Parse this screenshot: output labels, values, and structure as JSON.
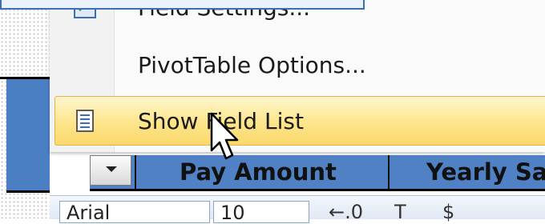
{
  "menu": {
    "items": [
      {
        "label": "Field Settings...",
        "icon": "field-settings-icon"
      },
      {
        "label": "PivotTable Options...",
        "icon": ""
      },
      {
        "label": "Show Field List",
        "icon": "field-list-icon",
        "highlighted": true
      }
    ]
  },
  "pivot_header": {
    "columns": [
      "Pay Amount",
      "Yearly Sa"
    ]
  },
  "format_toolbar": {
    "font_name": "Arial",
    "font_size": "10"
  },
  "colors": {
    "menu_highlight": "#fde58a",
    "header_blue": "#4f81c4"
  }
}
